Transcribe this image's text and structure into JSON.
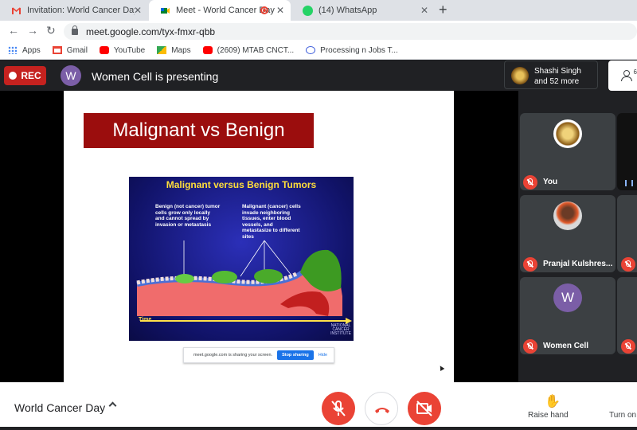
{
  "tabs": [
    {
      "title": "Invitation: World Cancer Day @ T",
      "icon": "gmail-icon"
    },
    {
      "title": "Meet - World Cancer Day",
      "icon": "meet-icon"
    },
    {
      "title": "(14) WhatsApp",
      "icon": "whatsapp-icon"
    }
  ],
  "url": "meet.google.com/tyx-fmxr-qbb",
  "bookmarks": [
    "Apps",
    "Gmail",
    "YouTube",
    "Maps",
    "(2609) MTAB CNCT...",
    "Processing n Jobs T..."
  ],
  "meet": {
    "rec_label": "REC",
    "presenter_initial": "W",
    "presenting_text": "Women Cell is presenting",
    "top_presenter_name": "Shashi Singh",
    "top_presenter_more": "and 52 more",
    "people_count": "6"
  },
  "slide": {
    "title": "Malignant vs Benign",
    "diagram_title": "Malignant versus Benign Tumors",
    "benign_text": "Benign (not cancer) tumor cells grow only locally and cannot spread by invasion or metastasis",
    "malignant_text": "Malignant (cancer) cells invade neighboring tissues, enter blood vessels, and metastasize to different sites",
    "time_label": "Time",
    "nci_label": "NATIONAL CANCER INSTITUTE"
  },
  "share_bar": {
    "text": "meet.google.com is sharing your screen.",
    "stop_label": "Stop sharing",
    "hide_label": "Hide"
  },
  "participants": [
    {
      "name": "You",
      "avatar": "emblem"
    },
    {
      "name": "Pranjal Kulshres...",
      "avatar": "photo"
    },
    {
      "name": "Women Cell",
      "avatar": "W",
      "color": "#7b5ea7"
    }
  ],
  "bottom": {
    "meeting_name": "World Cancer Day",
    "raise_hand": "Raise hand",
    "turn_on": "Turn on"
  },
  "colors": {
    "rec": "#c5221f",
    "slide_title_bg": "#9b0d0d",
    "control_red": "#ea4335"
  }
}
